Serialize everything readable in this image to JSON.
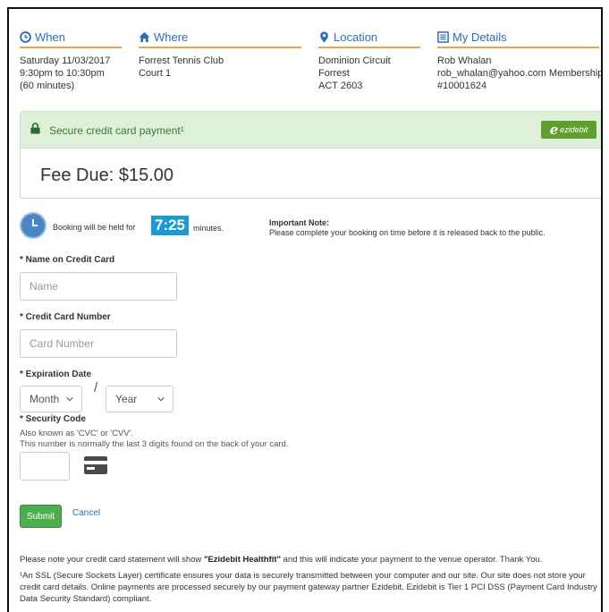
{
  "when": {
    "title": "When",
    "lines": [
      "Saturday 11/03/2017",
      "9:30pm to 10:30pm",
      "(60 minutes)"
    ]
  },
  "where": {
    "title": "Where",
    "lines": [
      "Forrest Tennis Club",
      "Court 1"
    ]
  },
  "location": {
    "title": "Location",
    "lines": [
      "Dominion Circuit",
      "Forrest",
      "ACT 2603"
    ]
  },
  "details": {
    "title": "My Details",
    "lines": [
      "Rob Whalan",
      "rob_whalan@yahoo.com Membership",
      "#10001624"
    ]
  },
  "payment": {
    "secure_label": "Secure credit card payment¹",
    "logo_text": "ezidebit",
    "fee_label": "Fee Due: $15.00"
  },
  "timer": {
    "label_before": "Booking will be held for",
    "value": "7:25",
    "label_after": "minutes.",
    "note_title": "Important Note:",
    "note_text": "Please complete your booking on time before it is released back to the public."
  },
  "form": {
    "name_label": "* Name on Credit Card",
    "name_placeholder": "Name",
    "card_label": "* Credit Card Number",
    "card_placeholder": "Card Number",
    "expiry_label": "* Expiration Date",
    "month_value": "Month",
    "year_value": "Year",
    "separator": "/",
    "security_label": "* Security Code",
    "security_help1": "Also known as 'CVC' or 'CVV'.",
    "security_help2": "This number is normally the last 3 digits found on the back of your card.",
    "submit_label": "Submit",
    "cancel_label": "Cancel"
  },
  "footer": {
    "statement_before": "Please note your credit card statement will show ",
    "statement_bold": "\"Ezidebit Healthfit\"",
    "statement_after": " and this will indicate your payment to the venue operator. Thank You.",
    "ssl_text": "¹An SSL (Secure Sockets Layer) certificate ensures your data is securely transmitted between your computer and our site. Our site does not store your credit card details. Online payments are processed securely by our payment gateway partner Ezidebit. Ezidebit is Tier 1 PCI DSS (Payment Card Industry Data Security Standard) compliant."
  },
  "colors": {
    "link_blue": "#2a6ebb",
    "rule_orange": "#f0a04a",
    "success_green": "#4cae4c",
    "panel_green": "#dff0d8",
    "timer_blue": "#1a9ad6"
  }
}
